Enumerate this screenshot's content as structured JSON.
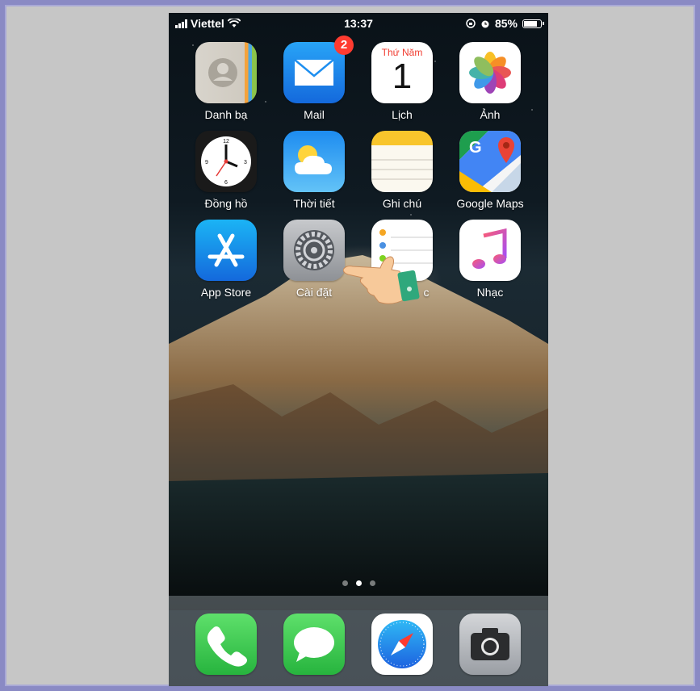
{
  "status_bar": {
    "carrier": "Viettel",
    "time": "13:37",
    "battery": "85%",
    "battery_level": 0.85
  },
  "home_apps": [
    {
      "label": "Danh bạ",
      "icon": "contacts-icon"
    },
    {
      "label": "Mail",
      "icon": "mail-icon",
      "badge": "2"
    },
    {
      "label": "Lịch",
      "icon": "calendar-icon",
      "calendar_day": "Thứ Năm",
      "calendar_date": "1"
    },
    {
      "label": "Ảnh",
      "icon": "photos-icon"
    },
    {
      "label": "Đồng hồ",
      "icon": "clock-icon"
    },
    {
      "label": "Thời tiết",
      "icon": "weather-icon"
    },
    {
      "label": "Ghi chú",
      "icon": "notes-icon"
    },
    {
      "label": "Google Maps",
      "icon": "google-maps-icon"
    },
    {
      "label": "App Store",
      "icon": "app-store-icon"
    },
    {
      "label": "Cài đặt",
      "icon": "settings-icon"
    },
    {
      "label": "c",
      "icon": "reminders-icon"
    },
    {
      "label": "Nhạc",
      "icon": "music-icon"
    }
  ],
  "page_dots": {
    "count": 3,
    "active_index": 1
  },
  "dock": [
    {
      "icon": "phone-icon"
    },
    {
      "icon": "messages-icon"
    },
    {
      "icon": "safari-icon"
    },
    {
      "icon": "camera-icon"
    }
  ],
  "colors": {
    "badge": "#ff3b30",
    "mail": "#1e8ff0",
    "app_store": "#1a8df5",
    "phone": "#35c94a",
    "messages": "#35c94a"
  }
}
